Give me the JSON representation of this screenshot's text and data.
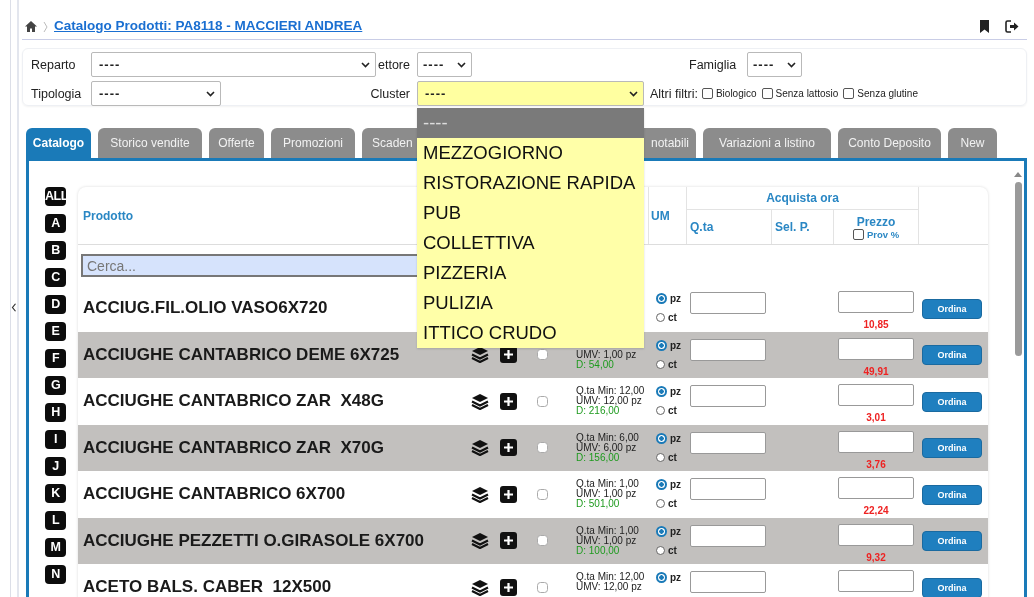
{
  "breadcrumb": {
    "link": "Catalogo Prodotti: PA8118 - MACCIERI ANDREA"
  },
  "filters": {
    "reparto": {
      "label": "Reparto",
      "value": "----"
    },
    "settore": {
      "label": "ettore",
      "value": "----"
    },
    "famiglia": {
      "label": "Famiglia",
      "value": "----"
    },
    "tipologia": {
      "label": "Tipologia",
      "value": "----"
    },
    "cluster": {
      "label": "Cluster",
      "value": "----",
      "open": true,
      "options": [
        {
          "label": "----",
          "selected": true
        },
        {
          "label": "MEZZOGIORNO",
          "selected": false
        },
        {
          "label": "RISTORAZIONE RAPIDA",
          "selected": false
        },
        {
          "label": "PUB",
          "selected": false
        },
        {
          "label": "COLLETTIVA",
          "selected": false
        },
        {
          "label": "PIZZERIA",
          "selected": false
        },
        {
          "label": "PULIZIA",
          "selected": false
        },
        {
          "label": "ITTICO CRUDO",
          "selected": false
        }
      ]
    },
    "altri_filtri": {
      "label": "Altri filtri:",
      "options": [
        {
          "label": "Biologico",
          "checked": false
        },
        {
          "label": "Senza lattosio",
          "checked": false
        },
        {
          "label": "Senza glutine",
          "checked": false
        }
      ]
    }
  },
  "tabs": [
    {
      "label": "Catalogo",
      "selected": true
    },
    {
      "label": "Storico vendite",
      "selected": false
    },
    {
      "label": "Offerte",
      "selected": false
    },
    {
      "label": "Promozioni",
      "selected": false
    },
    {
      "label": "Scaden",
      "selected": false
    },
    {
      "label": "notabili",
      "selected": false
    },
    {
      "label": "Variazioni a listino",
      "selected": false
    },
    {
      "label": "Conto Deposito",
      "selected": false
    },
    {
      "label": "New",
      "selected": false
    }
  ],
  "letters": [
    "ALL",
    "A",
    "B",
    "C",
    "D",
    "E",
    "F",
    "G",
    "H",
    "I",
    "J",
    "K",
    "L",
    "M",
    "N"
  ],
  "table": {
    "header": {
      "product": "Prodotto",
      "um": "UM",
      "group": "Acquista ora",
      "qty": "Q.ta",
      "sel": "Sel. P.",
      "price": "Prezzo",
      "prov": {
        "label": "Prov %",
        "checked": false
      }
    },
    "search": {
      "placeholder": "Cerca..."
    },
    "rows": [
      {
        "name": "ACCIUG.FIL.OLIO VASO6X720",
        "controls_hidden": true,
        "info": [],
        "units": [
          {
            "label": "pz",
            "selected": true
          },
          {
            "label": "ct",
            "selected": false
          }
        ],
        "price": "10,85",
        "order": "Ordina"
      },
      {
        "name": "ACCIUGHE CANTABRICO DEME 6X725",
        "checked": false,
        "info": [
          {
            "kind": "umv",
            "text": "UMV: 1,00 pz"
          },
          {
            "kind": "available",
            "text": "D: 54,00"
          }
        ],
        "units": [
          {
            "label": "pz",
            "selected": true
          },
          {
            "label": "ct",
            "selected": false
          }
        ],
        "price": "49,91",
        "order": "Ordina"
      },
      {
        "name": "ACCIUGHE CANTABRICO ZAR  X48G",
        "checked": false,
        "info": [
          {
            "kind": "min",
            "text": "Q.ta Min: 12,00"
          },
          {
            "kind": "umv",
            "text": "UMV: 12,00 pz"
          },
          {
            "kind": "available",
            "text": "D: 216,00"
          }
        ],
        "units": [
          {
            "label": "pz",
            "selected": true
          },
          {
            "label": "ct",
            "selected": false
          }
        ],
        "price": "3,01",
        "order": "Ordina"
      },
      {
        "name": "ACCIUGHE CANTABRICO ZAR  X70G",
        "checked": false,
        "info": [
          {
            "kind": "min",
            "text": "Q.ta Min: 6,00"
          },
          {
            "kind": "umv",
            "text": "UMV: 6,00 pz"
          },
          {
            "kind": "available",
            "text": "D: 156,00"
          }
        ],
        "units": [
          {
            "label": "pz",
            "selected": true
          },
          {
            "label": "ct",
            "selected": false
          }
        ],
        "price": "3,76",
        "order": "Ordina"
      },
      {
        "name": "ACCIUGHE CANTABRICO 6X700",
        "checked": false,
        "info": [
          {
            "kind": "min",
            "text": "Q.ta Min: 1,00"
          },
          {
            "kind": "umv",
            "text": "UMV: 1,00 pz"
          },
          {
            "kind": "available",
            "text": "D: 501,00"
          }
        ],
        "units": [
          {
            "label": "pz",
            "selected": true
          },
          {
            "label": "ct",
            "selected": false
          }
        ],
        "price": "22,24",
        "order": "Ordina"
      },
      {
        "name": "ACCIUGHE PEZZETTI O.GIRASOLE 6X700",
        "checked": false,
        "info": [
          {
            "kind": "min",
            "text": "Q.ta Min: 1,00"
          },
          {
            "kind": "umv",
            "text": "UMV: 1,00 pz"
          },
          {
            "kind": "available",
            "text": "D: 100,00"
          }
        ],
        "units": [
          {
            "label": "pz",
            "selected": true
          },
          {
            "label": "ct",
            "selected": false
          }
        ],
        "price": "9,32",
        "order": "Ordina"
      },
      {
        "name": "ACETO BALS. CABER  12X500",
        "checked": false,
        "info": [
          {
            "kind": "min",
            "text": "Q.ta Min: 12,00"
          },
          {
            "kind": "umv",
            "text": "UMV: 12,00 pz"
          }
        ],
        "units": [
          {
            "label": "pz",
            "selected": true
          }
        ],
        "order": "Ordina"
      }
    ]
  }
}
